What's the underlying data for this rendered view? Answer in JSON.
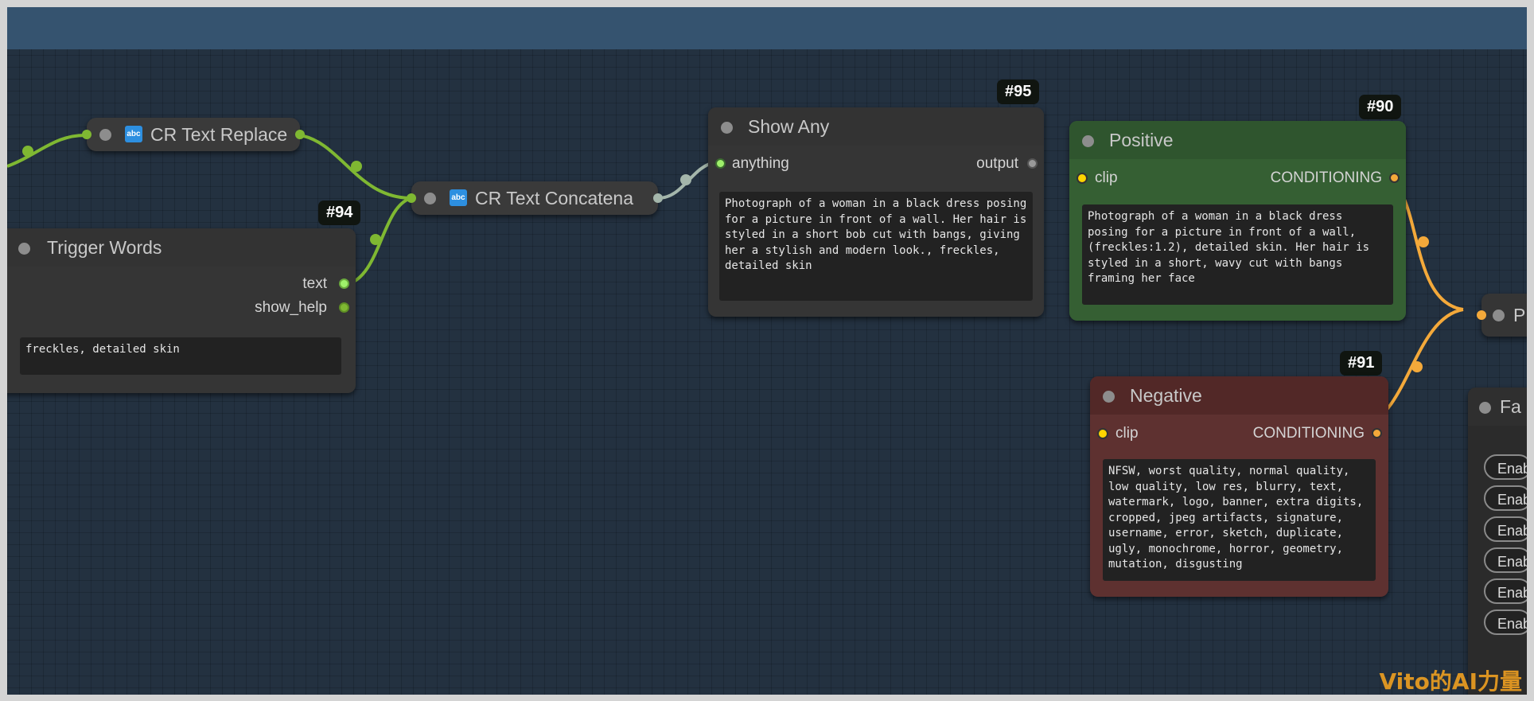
{
  "nodes": {
    "text_replace": {
      "title": "CR Text Replace",
      "icon": "abc"
    },
    "trigger_words": {
      "title": "Trigger Words",
      "badge": "#94",
      "outputs": [
        "text",
        "show_help"
      ],
      "text": "freckles, detailed skin"
    },
    "text_concat": {
      "title": "CR Text Concatena",
      "icon": "abc"
    },
    "show_any": {
      "title": "Show Any",
      "badge": "#95",
      "input": "anything",
      "output": "output",
      "text": "Photograph of a woman in a black dress posing for a picture in front of a wall. Her hair is styled in a short bob cut with bangs, giving her a stylish and modern look., freckles, detailed skin"
    },
    "positive": {
      "title": "Positive",
      "badge": "#90",
      "input": "clip",
      "output": "CONDITIONING",
      "text": "Photograph of a woman in a black dress posing for a picture in front of a wall, (freckles:1.2), detailed skin. Her hair is styled in a short, wavy cut with bangs framing her face"
    },
    "negative": {
      "title": "Negative",
      "badge": "#91",
      "input": "clip",
      "output": "CONDITIONING",
      "text": "NFSW, worst quality, normal quality, low quality, low res, blurry, text, watermark, logo, banner, extra digits, cropped, jpeg artifacts, signature, username, error, sketch, duplicate, ugly, monochrome, horror, geometry, mutation, disgusting"
    },
    "fast": {
      "title": "Fa",
      "buttons": [
        "Enab",
        "Enab",
        "Enab",
        "Enab",
        "Enab",
        "Enab"
      ]
    },
    "partial": {
      "title": "P"
    }
  },
  "colors": {
    "string_link": "#7fb832",
    "conditioning_link": "#f4a93a",
    "any_link": "#a4b6ab",
    "positive_node": "#355f33",
    "negative_node": "#5e3130"
  },
  "watermark": "Vito的AI力量"
}
